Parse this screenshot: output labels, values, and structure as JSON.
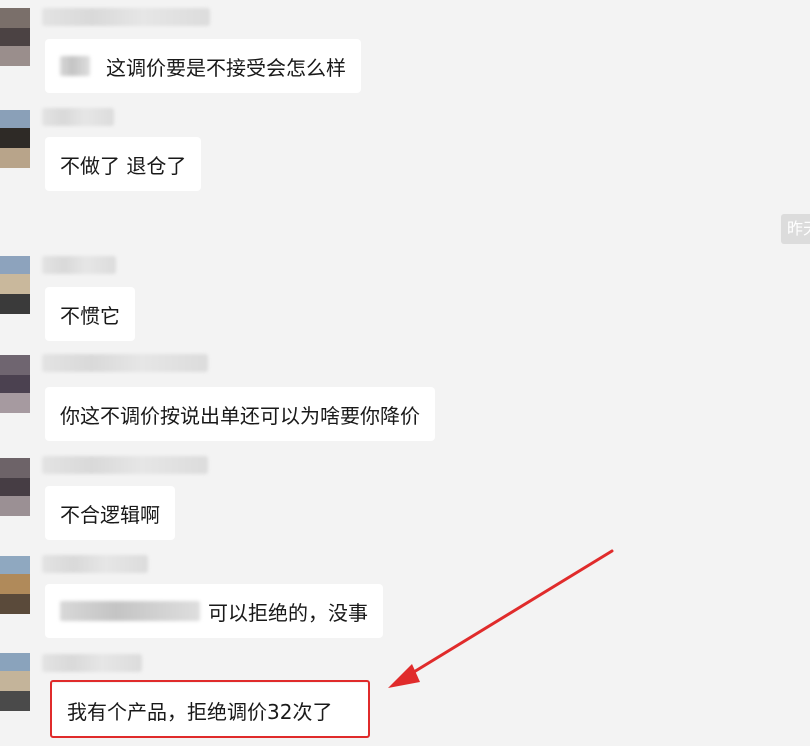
{
  "colors": {
    "background": "#f3f3f3",
    "bubble": "#ffffff",
    "timestamp_bg": "#dcdcdc",
    "annotation": "#e02b2b"
  },
  "chat": {
    "timestamp": "昨天",
    "messages": [
      {
        "text": "这调价要是不接受会怎么样",
        "sender_name_visible": false,
        "has_redacted_prefix": true
      },
      {
        "text": "不做了 退仓了",
        "sender_name_visible": false
      },
      {
        "text": "不惯它",
        "sender_name_visible": false
      },
      {
        "text": "你这不调价按说出单还可以为啥要你降价",
        "sender_name_visible": false
      },
      {
        "text": "不合逻辑啊",
        "sender_name_visible": false
      },
      {
        "text": "可以拒绝的，没事",
        "sender_name_visible": false,
        "has_redacted_prefix": true
      },
      {
        "text": "我有个产品，拒绝调价32次了",
        "sender_name_visible": false,
        "highlighted": true
      }
    ]
  },
  "annotation": {
    "type": "arrow-with-box",
    "target_message_index": 6,
    "color": "#e02b2b"
  }
}
